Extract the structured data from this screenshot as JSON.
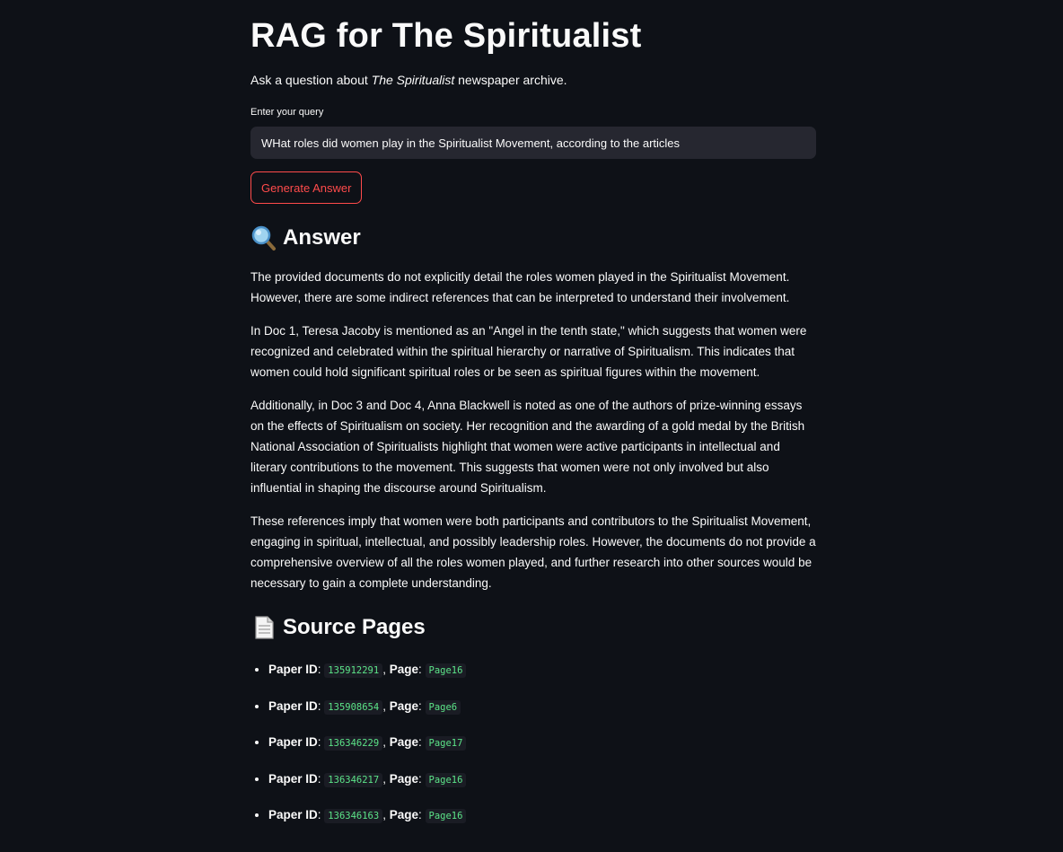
{
  "page": {
    "title": "RAG for The Spiritualist",
    "subtitle_prefix": "Ask a question about ",
    "subtitle_em": "The Spiritualist",
    "subtitle_suffix": " newspaper archive."
  },
  "query": {
    "label": "Enter your query",
    "value": "WHat roles did women play in the Spiritualist Movement, according to the articles"
  },
  "generate_button": {
    "label": "Generate Answer"
  },
  "answer": {
    "icon": "magnifying-glass-icon",
    "heading": "Answer",
    "paragraphs": [
      "The provided documents do not explicitly detail the roles women played in the Spiritualist Movement. However, there are some indirect references that can be interpreted to understand their involvement.",
      "In Doc 1, Teresa Jacoby is mentioned as an \"Angel in the tenth state,\" which suggests that women were recognized and celebrated within the spiritual hierarchy or narrative of Spiritualism. This indicates that women could hold significant spiritual roles or be seen as spiritual figures within the movement.",
      "Additionally, in Doc 3 and Doc 4, Anna Blackwell is noted as one of the authors of prize-winning essays on the effects of Spiritualism on society. Her recognition and the awarding of a gold medal by the British National Association of Spiritualists highlight that women were active participants in intellectual and literary contributions to the movement. This suggests that women were not only involved but also influential in shaping the discourse around Spiritualism.",
      "These references imply that women were both participants and contributors to the Spiritualist Movement, engaging in spiritual, intellectual, and possibly leadership roles. However, the documents do not provide a comprehensive overview of all the roles women played, and further research into other sources would be necessary to gain a complete understanding."
    ]
  },
  "sources": {
    "icon": "page-document-icon",
    "heading": "Source Pages",
    "paper_label": "Paper ID",
    "page_label": "Page",
    "items": [
      {
        "paper_id": "135912291",
        "page": "Page16"
      },
      {
        "paper_id": "135908654",
        "page": "Page6"
      },
      {
        "paper_id": "136346229",
        "page": "Page17"
      },
      {
        "paper_id": "136346217",
        "page": "Page16"
      },
      {
        "paper_id": "136346163",
        "page": "Page16"
      }
    ]
  },
  "colors": {
    "background": "#0e1117",
    "accent": "#ff4b4b",
    "code_text": "#5ce488",
    "input_bg": "#262730"
  }
}
